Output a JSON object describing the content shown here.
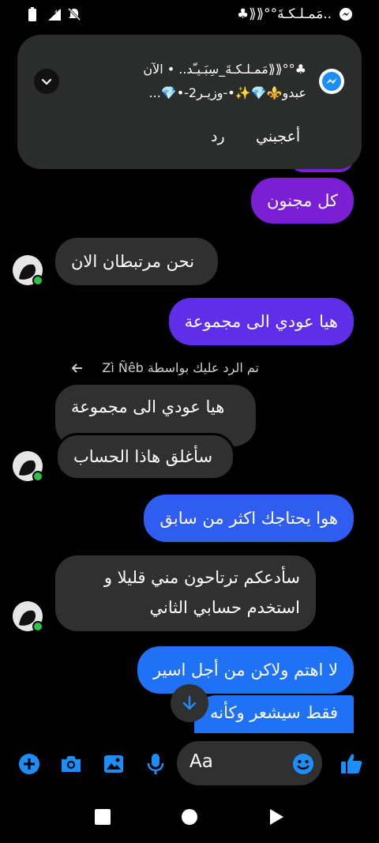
{
  "status_bar": {
    "left_icons": [
      "battery-icon",
      "network-4g-icon",
      "dnd-icon"
    ],
    "title": "..مَمـلـكـةَ°°⟪⟪♣",
    "right_icon": "messenger-icon"
  },
  "notification": {
    "line1": "♣°°⟪⟪مَمـلـكـةَ_سِبَـيـّد.. • الآن",
    "line2": "عبدو⚜️💎✨•-وزيـر2-•💎...",
    "actions": [
      "أعجبني",
      "رد"
    ]
  },
  "messages": [
    {
      "side": "out",
      "text": "كل مجنون"
    },
    {
      "side": "in",
      "text": "نحن مرتبطان الان"
    },
    {
      "side": "out",
      "text": "هيا عودي الى مجموعة"
    },
    {
      "side": "reply-note",
      "text": "تم الرد عليك بواسطة Zì Ñêb"
    },
    {
      "side": "in-quoted",
      "text": "هيا عودي الى مجموعة"
    },
    {
      "side": "in",
      "text": "سأغلق هاذا الحساب"
    },
    {
      "side": "out",
      "text": "هوا يحتاجك اكثر من سابق"
    },
    {
      "side": "in",
      "line1": "سأدعكم ترتاحون مني قليلا و",
      "line2": "استخدم حسابي الثاني"
    },
    {
      "side": "out",
      "text": "لا اهتم ولاكن من أجل اسير"
    },
    {
      "side": "out",
      "text": "فقط سيشعر وكأنه"
    }
  ],
  "composer": {
    "placeholder": "Aa",
    "icons": [
      "plus-icon",
      "camera-icon",
      "gallery-icon",
      "microphone-icon",
      "emoji-icon",
      "thumbs-up-icon"
    ]
  },
  "nav": [
    "recents-square-icon",
    "home-circle-icon",
    "back-triangle-icon"
  ],
  "colors": {
    "out_purple": "#7b1fd4",
    "out_violet": "#5f2ee8",
    "out_blue": "#2f5df0",
    "out_blue2": "#1f72f5",
    "in_gray": "#303030",
    "accent": "#1d8df7"
  }
}
